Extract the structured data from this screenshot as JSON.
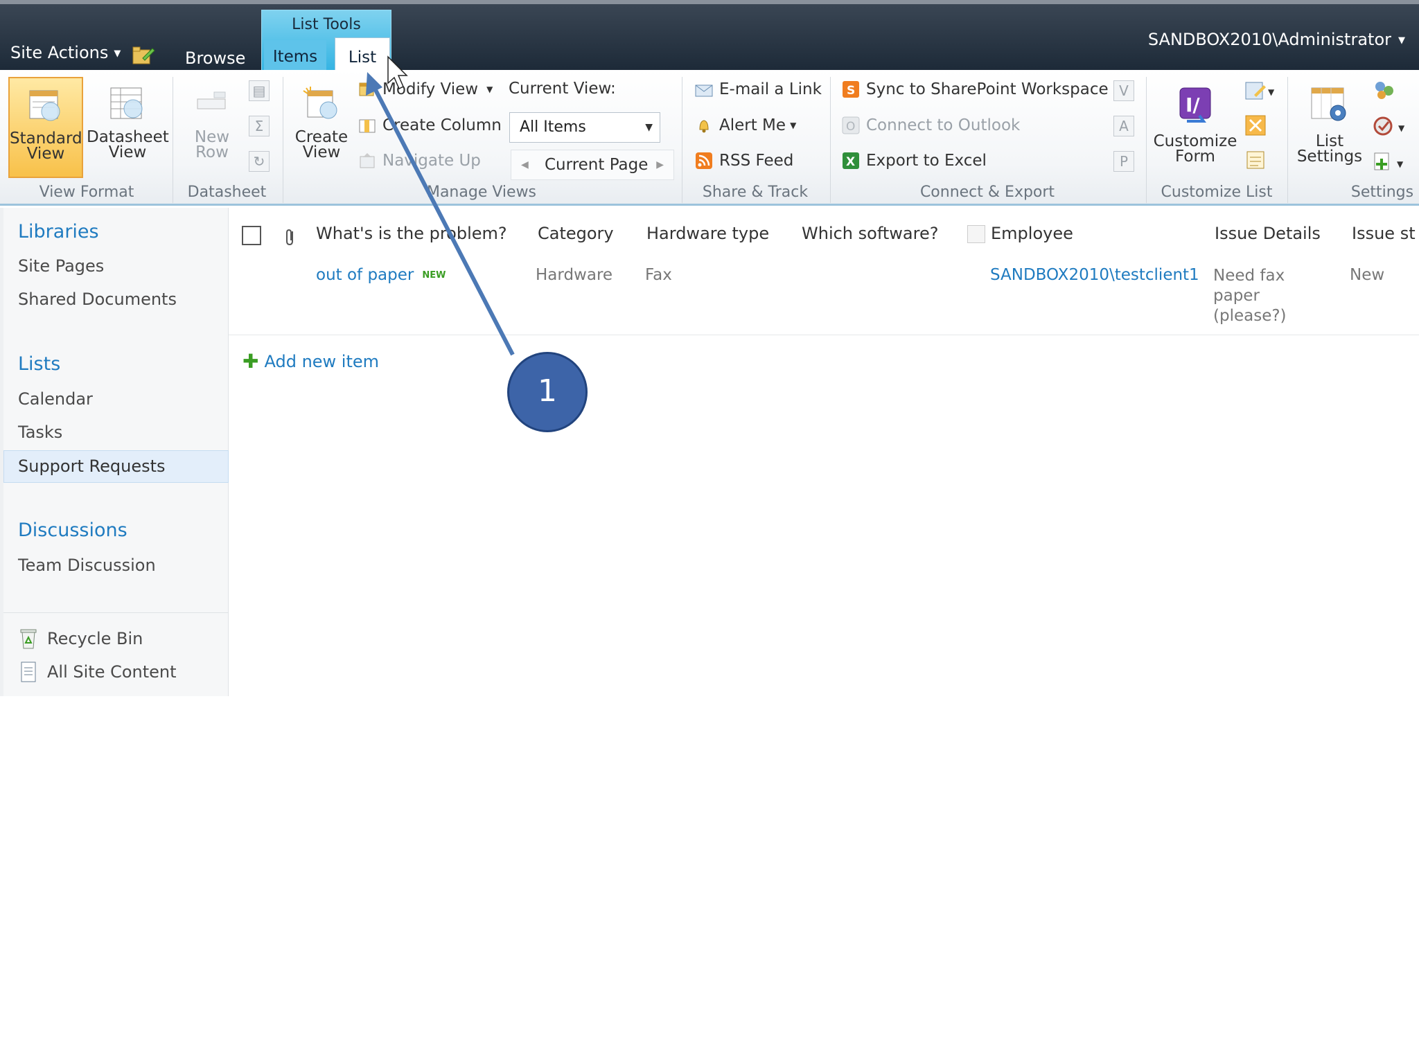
{
  "topbar": {
    "site_actions": "Site Actions",
    "tab_browse": "Browse",
    "context_group": "List Tools",
    "tab_items": "Items",
    "tab_list": "List",
    "user": "SANDBOX2010\\Administrator"
  },
  "ribbon": {
    "view_format": {
      "label": "View Format",
      "standard_view": "Standard View",
      "datasheet_view": "Datasheet View"
    },
    "datasheet": {
      "label": "Datasheet",
      "new_row": "New Row"
    },
    "manage_views": {
      "label": "Manage Views",
      "create_view": "Create View",
      "modify_view": "Modify View",
      "create_column": "Create Column",
      "navigate_up": "Navigate Up",
      "current_view_label": "Current View:",
      "current_view_value": "All Items",
      "current_page": "Current Page"
    },
    "share_track": {
      "label": "Share & Track",
      "email_link": "E-mail a Link",
      "alert_me": "Alert Me",
      "rss_feed": "RSS Feed"
    },
    "connect_export": {
      "label": "Connect & Export",
      "sync_workspace": "Sync to SharePoint Workspace",
      "connect_outlook": "Connect to Outlook",
      "export_excel": "Export to Excel"
    },
    "customize_list": {
      "label": "Customize List",
      "customize_form": "Customize Form"
    },
    "settings": {
      "label": "Settings",
      "list_settings": "List Settings"
    }
  },
  "leftnav": {
    "libraries": "Libraries",
    "site_pages": "Site Pages",
    "shared_documents": "Shared Documents",
    "lists": "Lists",
    "calendar": "Calendar",
    "tasks": "Tasks",
    "support_requests": "Support Requests",
    "discussions": "Discussions",
    "team_discussion": "Team Discussion",
    "recycle_bin": "Recycle Bin",
    "all_site_content": "All Site Content"
  },
  "list": {
    "columns": [
      "What's is the problem?",
      "Category",
      "Hardware type",
      "Which software?",
      "Employee",
      "Issue Details",
      "Issue st"
    ],
    "row": {
      "title": "out of paper",
      "new_badge": "NEW",
      "category": "Hardware",
      "hardware_type": "Fax",
      "employee": "SANDBOX2010\\testclient1",
      "details_line1": "Need fax",
      "details_line2": "paper",
      "details_line3": "(please?)",
      "status": "New"
    },
    "add_new_item": "Add new item"
  },
  "callout": {
    "number": "1"
  },
  "colors": {
    "topbar": "#1d2a38",
    "context_tab": "#35b4e3",
    "link": "#1f7bc0",
    "selected_button": "#f8c14a",
    "callout": "#3d64a8"
  }
}
